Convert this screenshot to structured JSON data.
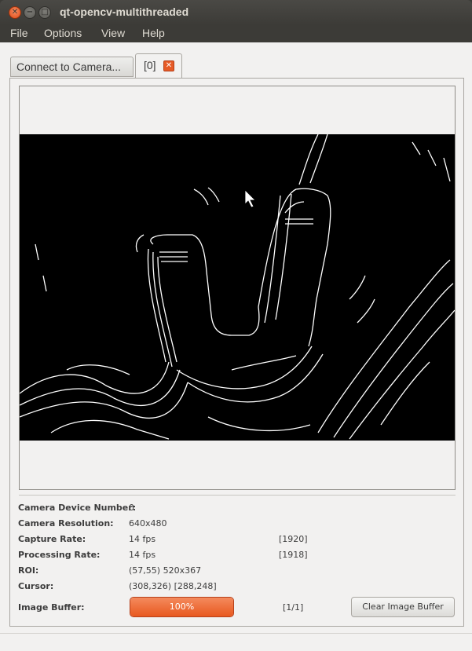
{
  "window": {
    "title": "qt-opencv-multithreaded",
    "controls": [
      "close-icon",
      "minimize-icon",
      "maximize-icon"
    ]
  },
  "menubar": {
    "items": [
      "File",
      "Options",
      "View",
      "Help"
    ]
  },
  "tabs": {
    "connect_label": "Connect to Camera...",
    "active_label": "[0]",
    "close_icon": "close-icon"
  },
  "info": {
    "rows": [
      {
        "label": "Camera Device Number:",
        "value": "0",
        "extra": ""
      },
      {
        "label": "Camera Resolution:",
        "value": "640x480",
        "extra": ""
      },
      {
        "label": "Capture Rate:",
        "value": "14 fps",
        "extra": "[1920]"
      },
      {
        "label": "Processing Rate:",
        "value": "14 fps",
        "extra": "[1918]"
      },
      {
        "label": "ROI:",
        "value": "(57,55) 520x367",
        "extra": ""
      },
      {
        "label": "Cursor:",
        "value": "(308,326) [288,248]",
        "extra": ""
      }
    ],
    "image_buffer": {
      "label": "Image Buffer:",
      "progress_percent": 100,
      "progress_text": "100%",
      "count": "[1/1]",
      "clear_button": "Clear Image Buffer"
    }
  },
  "colors": {
    "accent": "#e8591f",
    "titlebar": "#3c3b37",
    "window_bg": "#f2f1f0"
  }
}
